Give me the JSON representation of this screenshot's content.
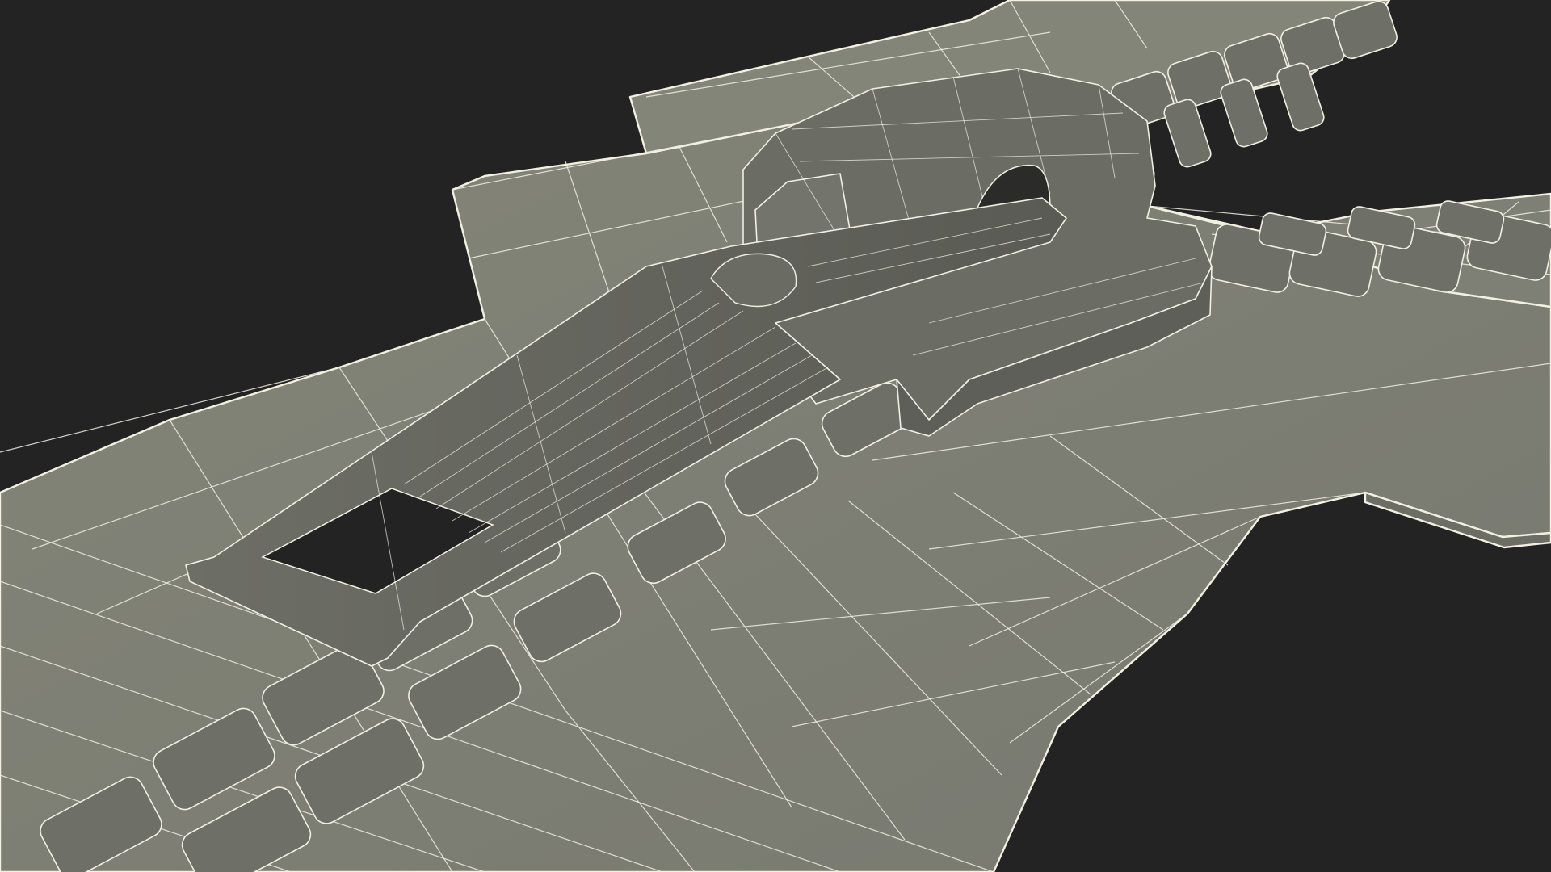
{
  "scene": {
    "subject": "zipper-slider-wireframe",
    "colors": {
      "background": "#232323",
      "surface": "#7e7f76",
      "surface_dark": "#5f6059",
      "surface_shadow": "#4e4f49",
      "wire": "#f0efe2"
    }
  }
}
